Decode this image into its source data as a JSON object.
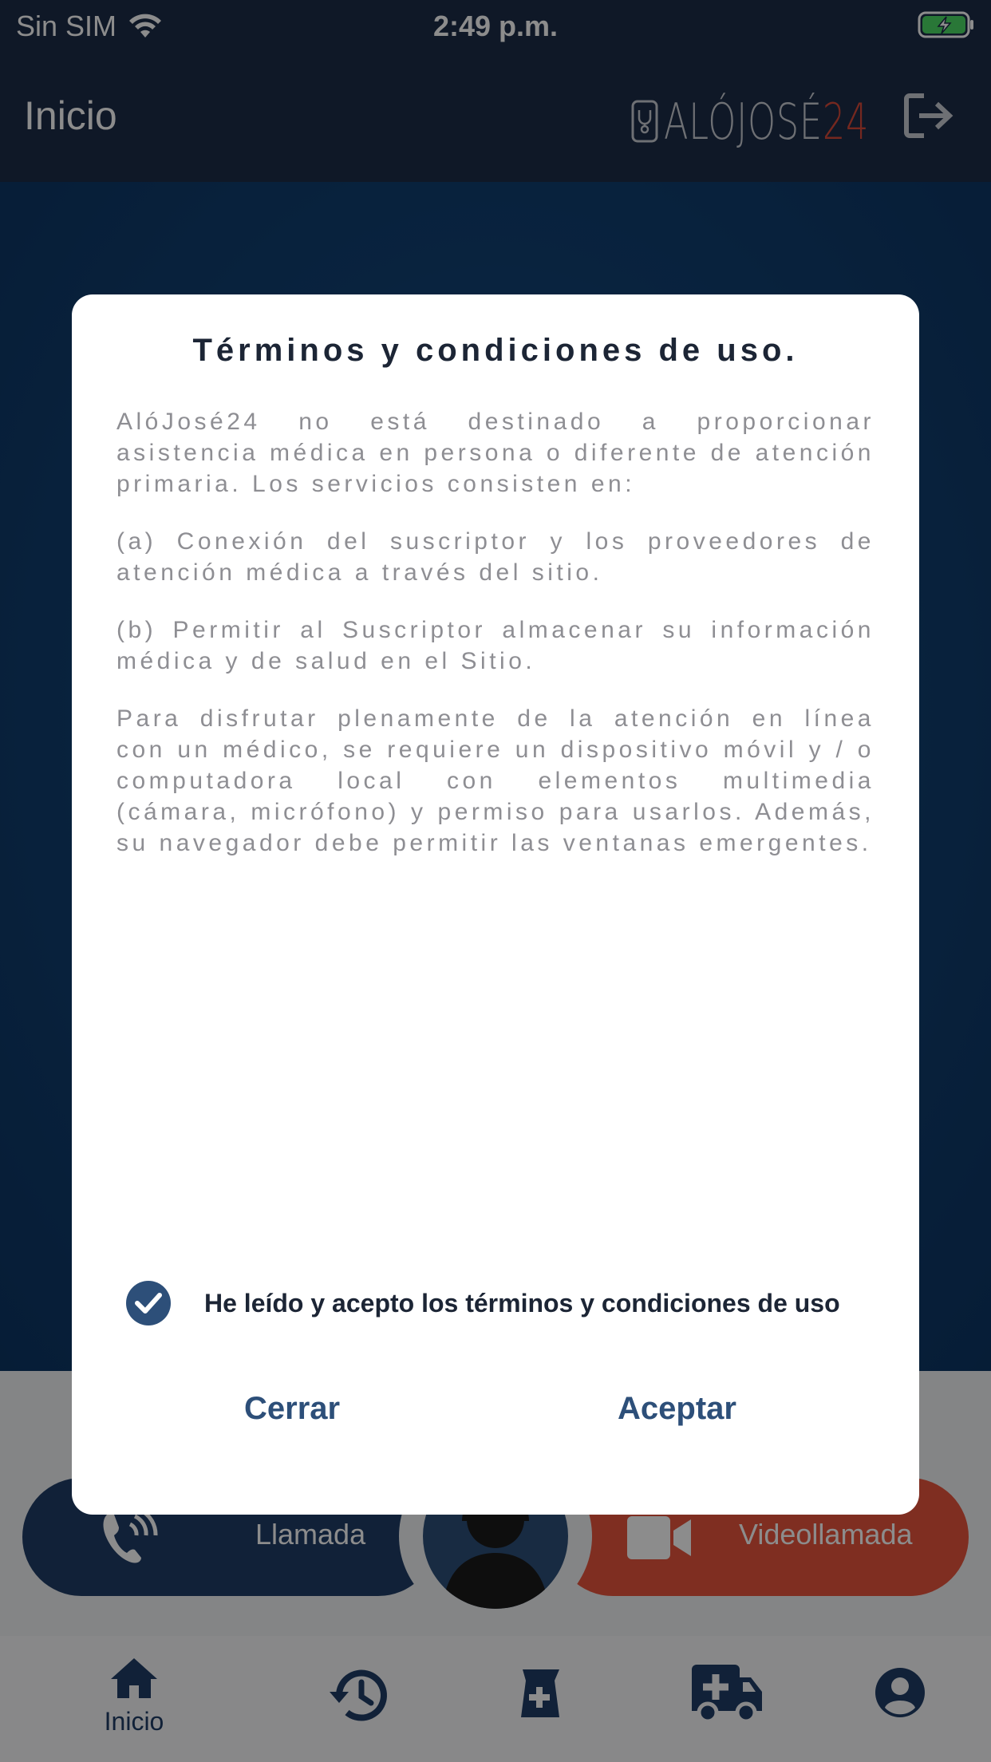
{
  "status_bar": {
    "carrier": "Sin SIM",
    "time": "2:49 p.m."
  },
  "header": {
    "title": "Inicio",
    "logo": "ALÓJOSÉ24"
  },
  "actions": {
    "call_label": "Llamada",
    "video_label": "Videollamada"
  },
  "nav": {
    "home_label": "Inicio"
  },
  "modal": {
    "title": "Términos y condiciones de uso.",
    "paragraphs": [
      "AlóJosé24 no está destinado a proporcionar asistencia médica en persona o diferente de atención primaria. Los servicios consisten en:",
      "(a) Conexión del suscriptor y los proveedores de atención médica a través del sitio.",
      "(b) Permitir al Suscriptor almacenar su información médica y de salud en el Sitio.",
      "Para disfrutar plenamente de la atención en línea con un médico, se requiere un dispositivo móvil y / o computadora local con elementos multimedia (cámara, micrófono) y permiso para usarlos. Además, su navegador debe permitir las ventanas emergentes."
    ],
    "checkbox_label": "He leído y acepto los términos y condiciones de uso",
    "checkbox_checked": true,
    "close_label": "Cerrar",
    "accept_label": "Aceptar"
  },
  "colors": {
    "primary": "#2d4f79",
    "header": "#1c2c48",
    "video": "#e8553d",
    "logo_accent": "#d64a3a"
  }
}
